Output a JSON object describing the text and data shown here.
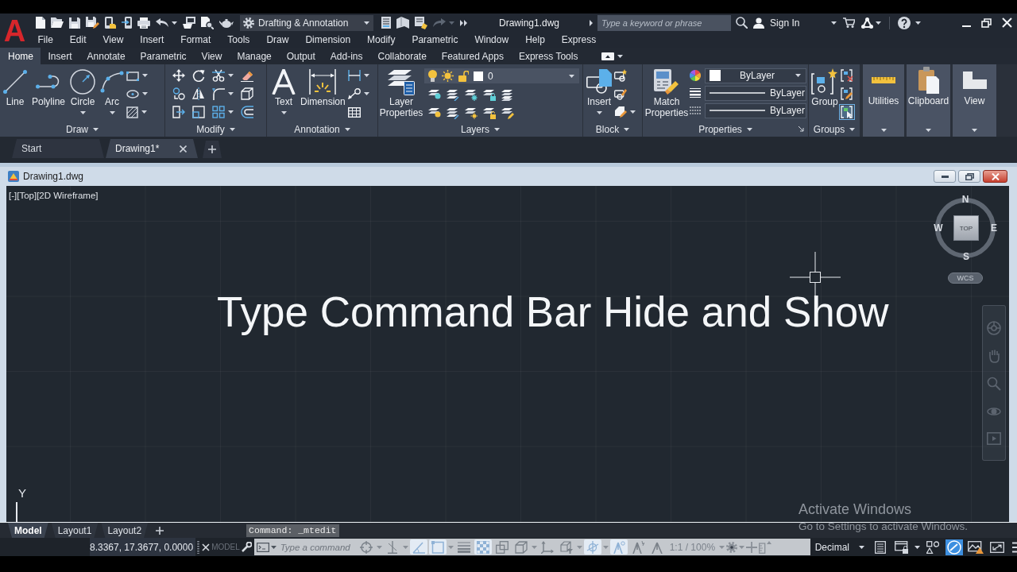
{
  "app": {
    "logo": "A"
  },
  "title_bar": {
    "workspace": "Drafting & Annotation",
    "document_title": "Drawing1.dwg",
    "search": {
      "placeholder": "Type a keyword or phrase"
    },
    "sign_in": "Sign In"
  },
  "menu_bar": [
    "File",
    "Edit",
    "View",
    "Insert",
    "Format",
    "Tools",
    "Draw",
    "Dimension",
    "Modify",
    "Parametric",
    "Window",
    "Help",
    "Express"
  ],
  "ribbon_tabs": [
    {
      "label": "Home",
      "selected": true
    },
    {
      "label": "Insert",
      "selected": false
    },
    {
      "label": "Annotate",
      "selected": false
    },
    {
      "label": "Parametric",
      "selected": false
    },
    {
      "label": "View",
      "selected": false
    },
    {
      "label": "Manage",
      "selected": false
    },
    {
      "label": "Output",
      "selected": false
    },
    {
      "label": "Add-ins",
      "selected": false
    },
    {
      "label": "Collaborate",
      "selected": false
    },
    {
      "label": "Featured Apps",
      "selected": false
    },
    {
      "label": "Express Tools",
      "selected": false
    }
  ],
  "ribbon": {
    "draw": {
      "title": "Draw",
      "tools": [
        {
          "label": "Line",
          "dropdown": false
        },
        {
          "label": "Polyline",
          "dropdown": false
        },
        {
          "label": "Circle",
          "dropdown": true
        },
        {
          "label": "Arc",
          "dropdown": true
        }
      ]
    },
    "modify": {
      "title": "Modify"
    },
    "annotation": {
      "title": "Annotation",
      "tools": [
        {
          "label": "Text",
          "dropdown": true
        },
        {
          "label": "Dimension",
          "dropdown": false
        }
      ]
    },
    "layers": {
      "title": "Layers",
      "tool": {
        "label": "Layer Properties"
      },
      "current_layer": "0"
    },
    "block": {
      "title": "Block",
      "tool": {
        "label": "Insert",
        "dropdown": true
      }
    },
    "properties": {
      "title": "Properties",
      "tool": {
        "label": "Match Properties"
      },
      "color_setting": "ByLayer",
      "lineweight": "ByLayer",
      "linetype": "ByLayer"
    },
    "groups": {
      "title": "Groups",
      "tool": {
        "label": "Group"
      },
      "toggles": [
        {
          "on": false
        },
        {
          "on": false
        },
        {
          "on": true
        }
      ]
    },
    "collapsed_panels": [
      {
        "label": "Utilities"
      },
      {
        "label": "Clipboard"
      },
      {
        "label": "View"
      }
    ]
  },
  "file_tabs": [
    {
      "label": "Start",
      "selected": false,
      "closable": false
    },
    {
      "label": "Drawing1*",
      "selected": true,
      "closable": true
    }
  ],
  "drawing_window": {
    "title": "Drawing1.dwg",
    "viewport_label": "[-][Top][2D Wireframe]",
    "viewcube": {
      "north": "N",
      "west": "W",
      "face": "TOP",
      "east": "E",
      "south": "S",
      "coordinate_system": "WCS"
    },
    "heading": "Type Command Bar Hide and Show",
    "ucs_axis": "Y"
  },
  "layout_tabs": [
    {
      "label": "Model",
      "selected": true
    },
    {
      "label": "Layout1",
      "selected": false
    },
    {
      "label": "Layout2",
      "selected": false
    }
  ],
  "command_history": "Command: _mtedit",
  "status_bar": {
    "coordinates": "8.3367, 17.3677, 0.0000",
    "space": "MODEL",
    "command_line": {
      "placeholder": "Type a command"
    },
    "toggles": [
      {
        "on": false,
        "dropdown": true
      },
      {
        "on": false,
        "dropdown": true
      },
      {
        "on": true,
        "dropdown": false
      },
      {
        "on": true,
        "dropdown": true
      },
      {
        "on": false,
        "dropdown": false
      },
      {
        "on": true,
        "dropdown": false
      },
      {
        "on": false,
        "dropdown": false
      },
      {
        "on": false,
        "dropdown": true
      },
      {
        "on": false,
        "dropdown": false
      },
      {
        "on": false,
        "dropdown": true
      },
      {
        "on": true,
        "dropdown": true
      },
      {
        "on": true,
        "dropdown": false
      },
      {
        "on": false,
        "dropdown": false
      },
      {
        "on": false,
        "dropdown": false
      }
    ],
    "annotation_scale": "1:1 / 100%",
    "units": "Decimal",
    "tools": [
      {
        "on": false,
        "dropdown": false
      },
      {
        "on": false,
        "dropdown": true
      },
      {
        "on": false,
        "dropdown": false
      },
      {
        "on": true,
        "dropdown": false
      },
      {
        "on": false,
        "dropdown": false
      },
      {
        "on": false,
        "dropdown": false
      },
      {
        "on": false,
        "dropdown": false
      }
    ]
  },
  "system_notice": {
    "title": "Activate Windows",
    "message": "Go to Settings to activate Windows."
  }
}
